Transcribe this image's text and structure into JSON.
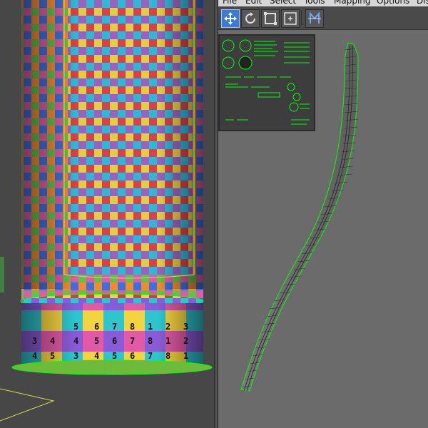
{
  "uv_menu": {
    "file": "File",
    "edit": "Edit",
    "select": "Select",
    "tools": "Tools",
    "mapping": "Mapping",
    "options": "Options",
    "display": "Dis"
  },
  "toolbar_tools": [
    "move-tool",
    "rotate-tool",
    "scale-tool",
    "freeform-tool",
    "mirror-tool"
  ],
  "texture_digits": [
    "1",
    "2",
    "3",
    "4",
    "5",
    "6",
    "7",
    "8"
  ],
  "checker_colors": [
    "#d93a3a",
    "#f28b2e",
    "#f4d340",
    "#5fc24a",
    "#2ec5cf",
    "#3d6fe0",
    "#8a5bd6",
    "#e25aa6",
    "#7f8a91",
    "#b86b3b"
  ],
  "accent_colors": {
    "selection": "#00ff00",
    "active_tool": "#3d7bd1",
    "gizmo": "#d9d94a"
  }
}
